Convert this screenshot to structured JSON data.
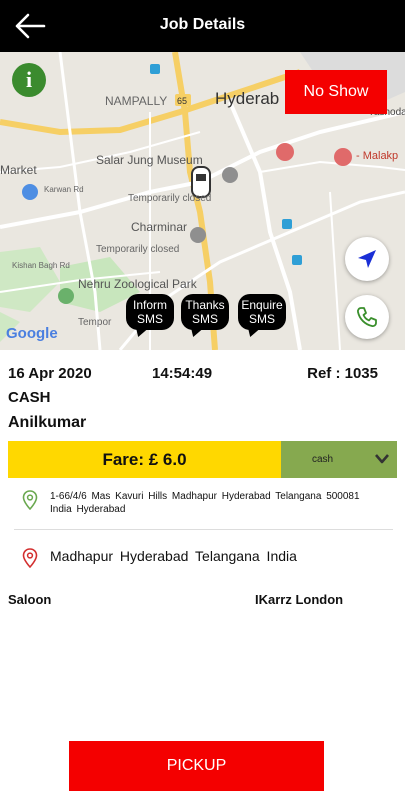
{
  "header": {
    "title": "Job Details"
  },
  "map": {
    "labels": {
      "nampally": "NAMPALLY",
      "hyderabad": "Hyderab",
      "salar_jung": "Salar Jung Museum",
      "temp_closed_1": "Temporarily closed",
      "market": "Market",
      "karwan": "Karwan Rd",
      "charminar": "Charminar",
      "temp_closed_2": "Temporarily closed",
      "kishan_bagh": "Kishan Bagh Rd",
      "nehru_zoo": "Nehru Zoological Park",
      "tempor": "Tempor",
      "yashoda": "Yashoda",
      "malakp": "- Malakp",
      "road_65": "65"
    },
    "google": "Google"
  },
  "buttons": {
    "info": "i",
    "no_show": "No Show",
    "pickup": "PICKUP"
  },
  "sms": [
    {
      "line1": "Inform",
      "line2": "SMS"
    },
    {
      "line1": "Thanks",
      "line2": "SMS"
    },
    {
      "line1": "Enquire",
      "line2": "SMS"
    }
  ],
  "job": {
    "date": "16 Apr 2020",
    "time": "14:54:49",
    "ref": "Ref : 1035",
    "payment_type": "CASH",
    "passenger": "Anilkumar",
    "fare": "Fare: £ 6.0",
    "payment_option": "cash",
    "pickup_address": "1-66/4/6 Mas Kavuri Hills Madhapur Hyderabad Telangana 500081 India Hyderabad",
    "drop_address": "Madhapur Hyderabad Telangana India",
    "vehicle": "Saloon",
    "company": "IKarrz London"
  },
  "colors": {
    "header": "#000000",
    "accent_red": "#f40000",
    "fare_yellow": "#ffd800",
    "select_green": "#86a94f",
    "info_green": "#3b8b2e"
  }
}
